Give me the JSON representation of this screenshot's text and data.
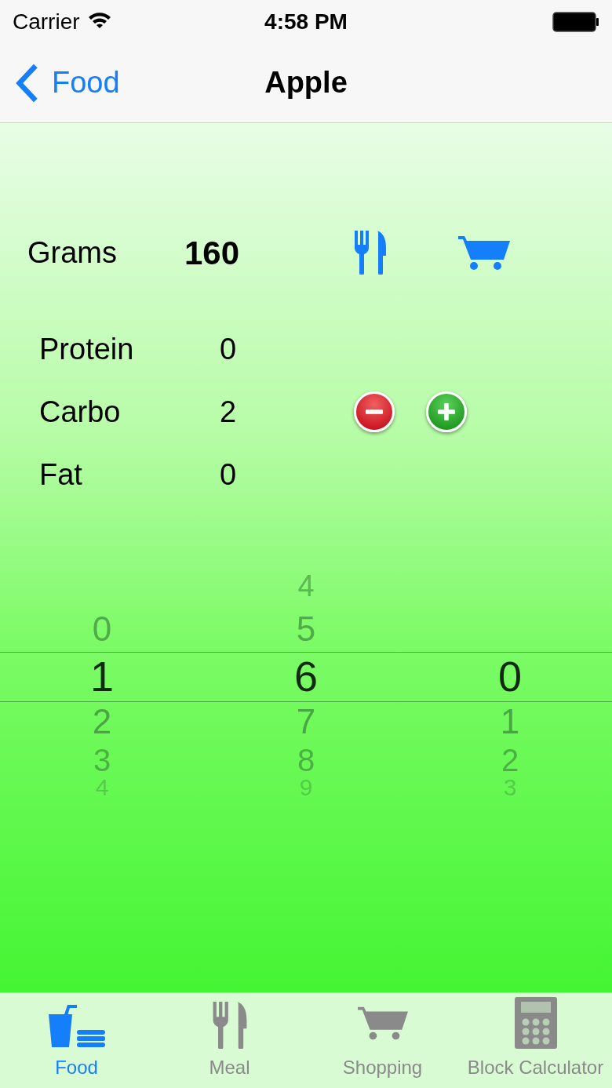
{
  "status_bar": {
    "carrier": "Carrier",
    "time": "4:58 PM"
  },
  "nav": {
    "back_label": "Food",
    "title": "Apple"
  },
  "grams": {
    "label": "Grams",
    "value": "160"
  },
  "nutrients": [
    {
      "label": "Protein",
      "value": "0"
    },
    {
      "label": "Carbo",
      "value": "2"
    },
    {
      "label": "Fat",
      "value": "0"
    }
  ],
  "picker": [
    {
      "items": [
        {
          "text": "0",
          "selected": false
        },
        {
          "text": "1",
          "selected": true
        },
        {
          "text": "2",
          "selected": false
        },
        {
          "text": "3",
          "selected": false
        },
        {
          "text": "4",
          "selected": false
        }
      ]
    },
    {
      "items": [
        {
          "text": "4",
          "selected": false
        },
        {
          "text": "5",
          "selected": false
        },
        {
          "text": "6",
          "selected": true
        },
        {
          "text": "7",
          "selected": false
        },
        {
          "text": "8",
          "selected": false
        },
        {
          "text": "9",
          "selected": false
        }
      ]
    },
    {
      "items": [
        {
          "text": "0",
          "selected": true
        },
        {
          "text": "1",
          "selected": false
        },
        {
          "text": "2",
          "selected": false
        },
        {
          "text": "3",
          "selected": false
        }
      ]
    }
  ],
  "tabs": [
    {
      "label": "Food",
      "kind": "food",
      "selected": true
    },
    {
      "label": "Meal",
      "kind": "meal",
      "selected": false
    },
    {
      "label": "Shopping",
      "kind": "shopping",
      "selected": false
    },
    {
      "label": "Block Calculator",
      "kind": "calculator",
      "selected": false
    }
  ]
}
